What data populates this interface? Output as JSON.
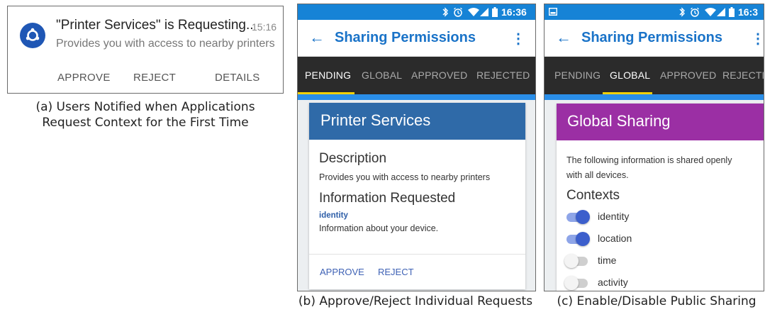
{
  "notification": {
    "title": "\"Printer Services\" is Requesting..",
    "time": "15:16",
    "body": "Provides you with access to nearby printers",
    "actions": [
      "APPROVE",
      "REJECT",
      "DETAILS"
    ],
    "caption_line1": "(a) Users Notified when Applications",
    "caption_line2": "Request Context for the First Time"
  },
  "phone_b": {
    "status_time": "16:36",
    "app_title": "Sharing Permissions",
    "tabs": [
      "PENDING",
      "GLOBAL",
      "APPROVED",
      "REJECTED"
    ],
    "active_tab": 0,
    "card_title": "Printer Services",
    "card_color": "#2f6aa8",
    "description_heading": "Description",
    "description_text": "Provides you with access to nearby printers",
    "info_heading": "Information Requested",
    "info_item_name": "identity",
    "info_item_desc": "Information about your device.",
    "actions": [
      "APPROVE",
      "REJECT"
    ],
    "caption": "(b) Approve/Reject Individual Requests"
  },
  "phone_c": {
    "status_time": "16:3",
    "app_title": "Sharing Permissions",
    "tabs": [
      "PENDING",
      "GLOBAL",
      "APPROVED",
      "REJECTED"
    ],
    "active_tab": 1,
    "card_title": "Global Sharing",
    "card_color": "#9b2fa4",
    "card_text_line1": "The following information is shared openly",
    "card_text_line2": "with all devices.",
    "contexts_heading": "Contexts",
    "contexts": [
      {
        "label": "identity",
        "enabled": true
      },
      {
        "label": "location",
        "enabled": true
      },
      {
        "label": "time",
        "enabled": false
      },
      {
        "label": "activity",
        "enabled": false
      }
    ],
    "caption": "(c) Enable/Disable Public Sharing"
  },
  "colors": {
    "accent_blue": "#1a73c8",
    "status_bar": "#1683d6",
    "tab_bar": "#2b2b2b",
    "tab_indicator": "#f5d000",
    "toggle_on": "#3c5fcc",
    "notif_icon": "#1f57b5"
  },
  "icons": [
    "bluetooth-icon",
    "alarm-icon",
    "wifi-icon",
    "signal-icon",
    "battery-icon",
    "back-arrow-icon",
    "overflow-menu-icon",
    "app-icon",
    "screenshot-icon"
  ]
}
